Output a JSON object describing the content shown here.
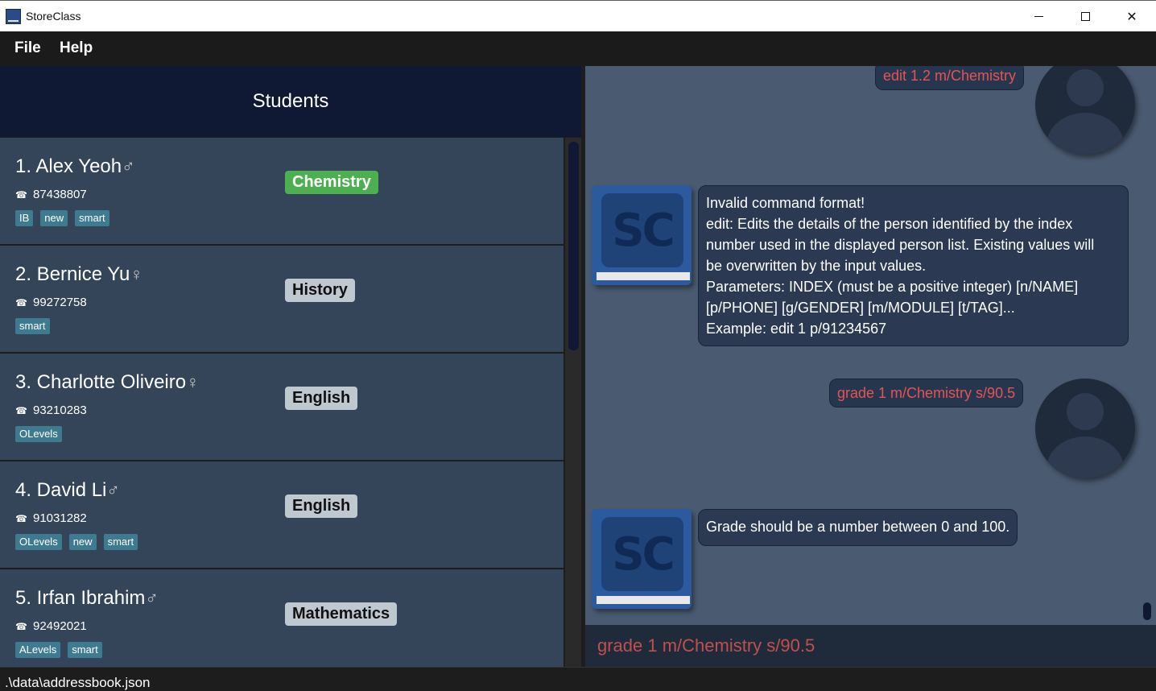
{
  "window": {
    "title": "StoreClass",
    "minimize_label": "",
    "close_symbol": "✕"
  },
  "menu": {
    "file": "File",
    "help": "Help"
  },
  "students_panel": {
    "title": "Students",
    "students": [
      {
        "name": "1. Alex Yeoh",
        "gender_symbol": "♂",
        "phone": "87438807",
        "tags": [
          "IB",
          "new",
          "smart"
        ],
        "module": "Chemistry",
        "module_color": "#4caf50"
      },
      {
        "name": "2. Bernice Yu",
        "gender_symbol": "♀",
        "phone": "99272758",
        "tags": [
          "smart"
        ],
        "module": "History",
        "module_color": "#bfc7cf"
      },
      {
        "name": "3. Charlotte Oliveiro",
        "gender_symbol": "♀",
        "phone": "93210283",
        "tags": [
          "OLevels"
        ],
        "module": "English",
        "module_color": "#bfc7cf"
      },
      {
        "name": "4. David Li",
        "gender_symbol": "♂",
        "phone": "91031282",
        "tags": [
          "OLevels",
          "new",
          "smart"
        ],
        "module": "English",
        "module_color": "#bfc7cf"
      },
      {
        "name": "5. Irfan Ibrahim",
        "gender_symbol": "♂",
        "phone": "92492021",
        "tags": [
          "ALevels",
          "smart"
        ],
        "module": "Mathematics",
        "module_color": "#bfc7cf"
      }
    ]
  },
  "chat": {
    "messages": [
      {
        "from": "user",
        "text": "edit 1.2 m/Chemistry"
      },
      {
        "from": "bot",
        "lines": [
          "Invalid command format!",
          "edit: Edits the details of the person identified by the index",
          "number used in the displayed person list. Existing values will",
          "be overwritten by the input values.",
          "Parameters: INDEX (must be a positive integer) [n/NAME]",
          "[p/PHONE] [g/GENDER] [m/MODULE] [t/TAG]...",
          "Example: edit 1 p/91234567"
        ]
      },
      {
        "from": "user",
        "text": "grade 1 m/Chemistry s/90.5"
      },
      {
        "from": "bot",
        "lines": [
          "Grade should be a number between 0 and 100."
        ]
      }
    ],
    "bot_avatar_text": "SC",
    "user_message_color": "#e35454"
  },
  "command_box": {
    "value": "grade 1 m/Chemistry s/90.5"
  },
  "status_bar": {
    "path": ".\\data\\addressbook.json"
  },
  "icons": {
    "phone": "phone-icon",
    "user_avatar": "user-avatar-icon",
    "bot_avatar": "storeclass-logo-icon"
  }
}
